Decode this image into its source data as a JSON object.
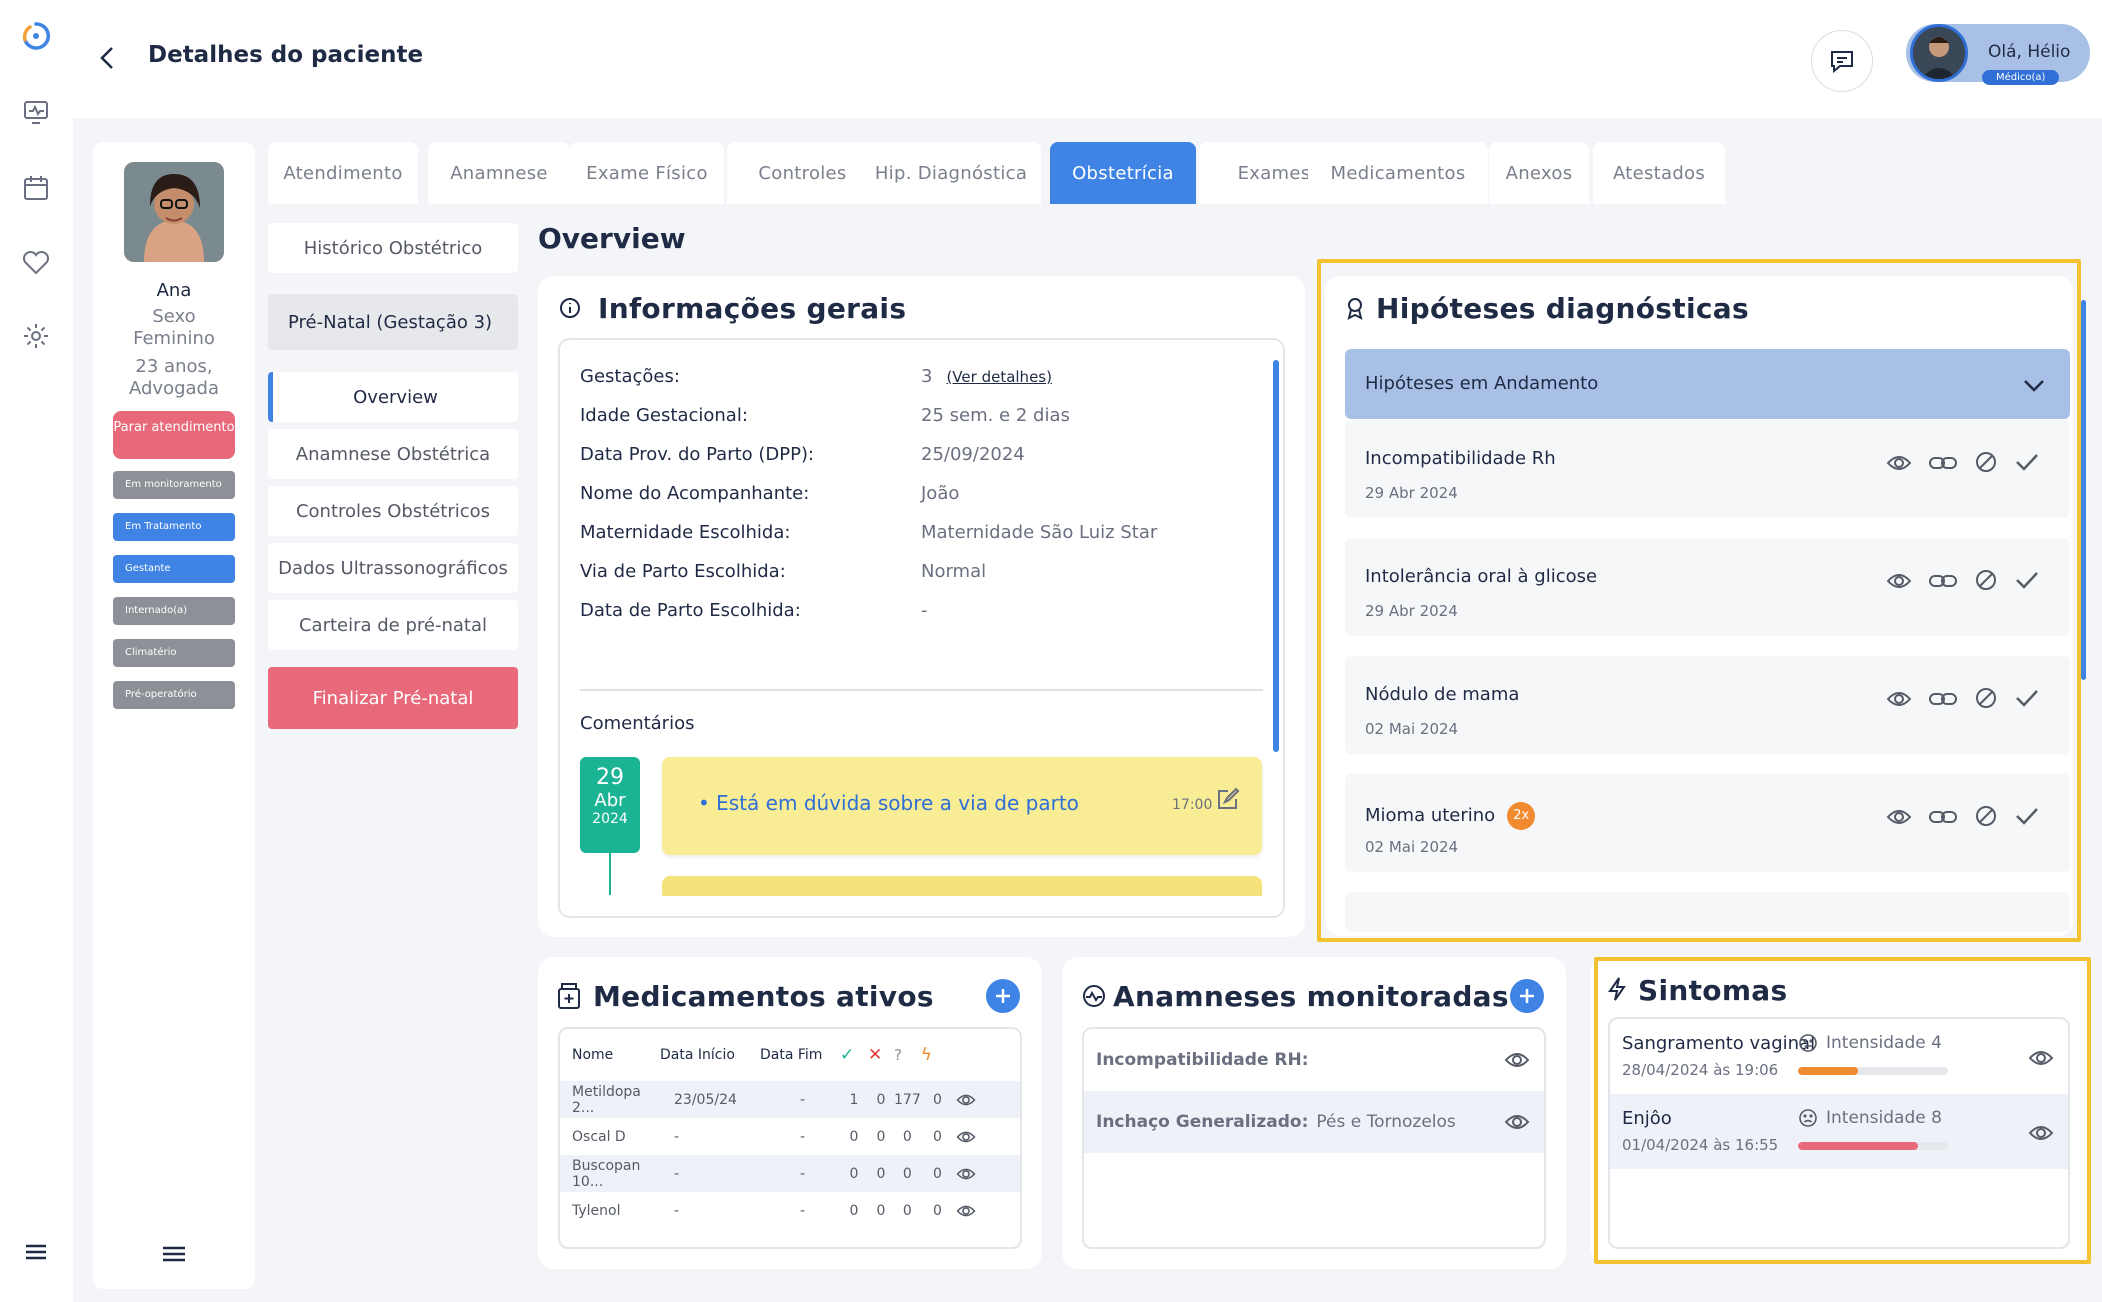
{
  "header": {
    "title": "Detalhes do paciente",
    "greeting": "Olá, Hélio",
    "role": "Médico(a)"
  },
  "patient": {
    "name": "Ana",
    "sex_label": "Sexo",
    "sex": "Feminino",
    "age": "23 anos,",
    "job": "Advogada",
    "stop_button": "Parar atendimento",
    "tags": [
      {
        "label": "Em monitoramento",
        "style": "grey"
      },
      {
        "label": "Em Tratamento",
        "style": "blue"
      },
      {
        "label": "Gestante",
        "style": "blue"
      },
      {
        "label": "Internado(a)",
        "style": "grey"
      },
      {
        "label": "Climatério",
        "style": "grey"
      },
      {
        "label": "Pré-operatório",
        "style": "grey"
      }
    ]
  },
  "tabs": [
    "Atendimento",
    "Anamnese",
    "Exame Físico",
    "Controles",
    "Hip. Diagnóstica",
    "Obstetrícia",
    "Exames",
    "Medicamentos",
    "Anexos",
    "Atestados"
  ],
  "active_tab": "Obstetrícia",
  "submenu": {
    "items": [
      "Histórico Obstétrico",
      "Pré-Natal (Gestação 3)",
      "Overview",
      "Anamnese Obstétrica",
      "Controles Obstétricos",
      "Dados Ultrassonográficos",
      "Carteira de pré-natal"
    ],
    "finalize": "Finalizar Pré-natal"
  },
  "overview_title": "Overview",
  "info": {
    "title": "Informações gerais",
    "rows": [
      {
        "label": "Gestações:",
        "value": "3",
        "link": "(Ver detalhes)"
      },
      {
        "label": "Idade Gestacional:",
        "value": "25 sem. e 2 dias"
      },
      {
        "label": "Data Prov. do Parto (DPP):",
        "value": "25/09/2024"
      },
      {
        "label": "Nome do Acompanhante:",
        "value": "João"
      },
      {
        "label": "Maternidade Escolhida:",
        "value": "Maternidade São Luiz Star"
      },
      {
        "label": "Via de Parto Escolhida:",
        "value": "Normal"
      },
      {
        "label": "Data de Parto Escolhida:",
        "value": "-"
      }
    ],
    "comments_label": "Comentários",
    "comment": {
      "day": "29",
      "month": "Abr",
      "year": "2024",
      "text": "Está em dúvida sobre a via de parto",
      "time": "17:00"
    }
  },
  "hipoteses": {
    "title": "Hipóteses diagnósticas",
    "group": "Hipóteses em Andamento",
    "items": [
      {
        "name": "Incompatibilidade Rh",
        "date": "29 Abr 2024"
      },
      {
        "name": "Intolerância oral à glicose",
        "date": "29 Abr 2024"
      },
      {
        "name": "Nódulo de mama",
        "date": "02 Mai 2024"
      },
      {
        "name": "Mioma uterino",
        "date": "02 Mai 2024",
        "badge": "2x"
      }
    ]
  },
  "medicamentos": {
    "title": "Medicamentos ativos",
    "columns": [
      "Nome",
      "Data Início",
      "Data Fim"
    ],
    "status_icons": [
      "check-icon",
      "x-icon",
      "question-icon",
      "bolt-icon"
    ],
    "status_glyphs": [
      "✓",
      "✕",
      "?",
      "ϟ"
    ],
    "colors": {
      "check": "#1ab394",
      "x": "#e53935",
      "question": "#8d9097",
      "bolt": "#f28a2f"
    },
    "rows": [
      {
        "name": "Metildopa 2...",
        "start": "23/05/24",
        "end": "-",
        "c1": "1",
        "c2": "0",
        "c3": "177",
        "c4": "0"
      },
      {
        "name": "Oscal D",
        "start": "-",
        "end": "-",
        "c1": "0",
        "c2": "0",
        "c3": "0",
        "c4": "0"
      },
      {
        "name": "Buscopan 10...",
        "start": "-",
        "end": "-",
        "c1": "0",
        "c2": "0",
        "c3": "0",
        "c4": "0"
      },
      {
        "name": "Tylenol",
        "start": "-",
        "end": "-",
        "c1": "0",
        "c2": "0",
        "c3": "0",
        "c4": "0"
      }
    ]
  },
  "anamneses": {
    "title": "Anamneses monitoradas",
    "rows": [
      {
        "label": "Incompatibilidade RH:",
        "value": ""
      },
      {
        "label": "Inchaço Generalizado:",
        "value": "Pés e Tornozelos"
      }
    ]
  },
  "sintomas": {
    "title": "Sintomas",
    "items": [
      {
        "name": "Sangramento vaginal",
        "date": "28/04/2024 às 19:06",
        "intensity": "Intensidade 4",
        "level": 0.4,
        "color": "#f28a2f"
      },
      {
        "name": "Enjôo",
        "date": "01/04/2024 às 16:55",
        "intensity": "Intensidade 8",
        "level": 0.8,
        "color": "#e8697a"
      }
    ]
  },
  "colors": {
    "accent": "#3f84e5",
    "danger": "#e8697a",
    "highlight": "#f2c230",
    "teal": "#1ab394"
  }
}
